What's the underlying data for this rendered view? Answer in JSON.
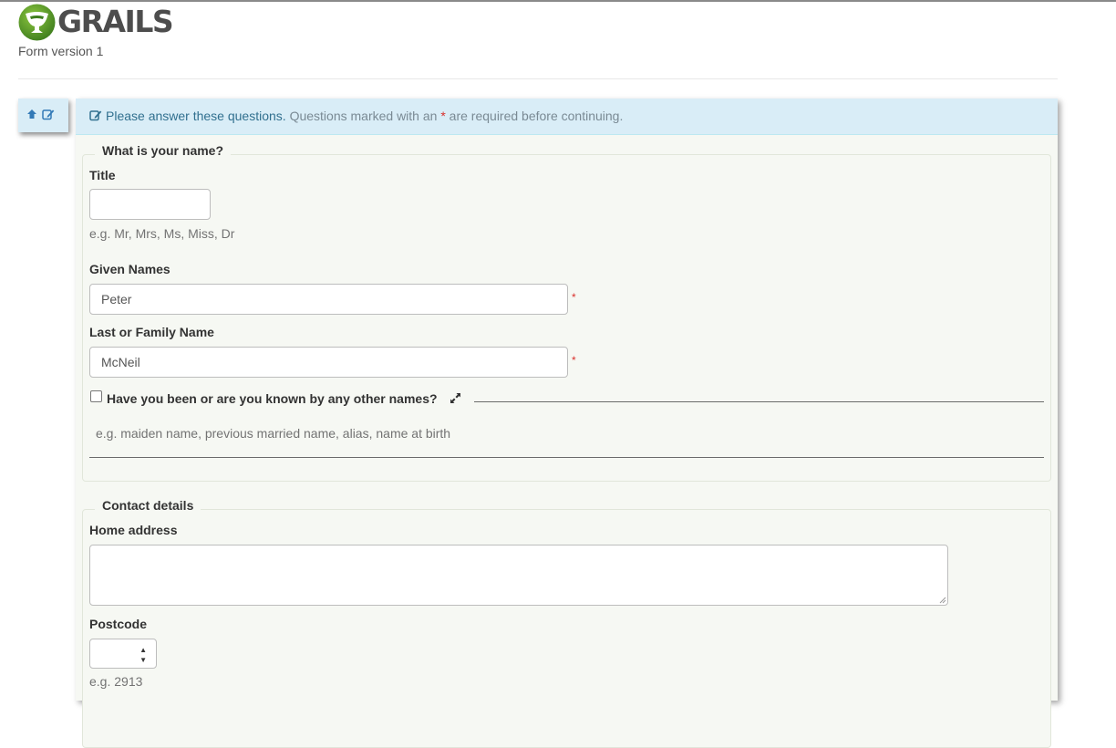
{
  "header": {
    "brand": "GRAILS",
    "version": "Form version 1"
  },
  "sidebar": {
    "icons": [
      "arrow-up-icon",
      "edit-icon"
    ]
  },
  "alert": {
    "lead": "Please answer these questions.",
    "text_before_star": "Questions marked with an",
    "star": "*",
    "text_after_star": "are required before continuing."
  },
  "name_section": {
    "legend": "What is your name?",
    "title": {
      "label": "Title",
      "value": "",
      "help": "e.g. Mr, Mrs, Ms, Miss, Dr"
    },
    "given_names": {
      "label": "Given Names",
      "value": "Peter",
      "required_marker": "*"
    },
    "last_name": {
      "label": "Last or Family Name",
      "value": "McNeil",
      "required_marker": "*"
    },
    "other_names": {
      "label": "Have you been or are you known by any other names?",
      "checked": false,
      "help": "e.g. maiden name, previous married name, alias, name at birth"
    }
  },
  "contact_section": {
    "legend": "Contact details",
    "home_address": {
      "label": "Home address",
      "value": ""
    },
    "postcode": {
      "label": "Postcode",
      "value": "",
      "help": "e.g. 2913"
    }
  },
  "colors": {
    "alert_bg": "#d9edf7",
    "alert_text": "#31708f",
    "panel_bg": "#f6f8f3",
    "required": "#d9302c",
    "logo_green": "#5a9a2e"
  }
}
